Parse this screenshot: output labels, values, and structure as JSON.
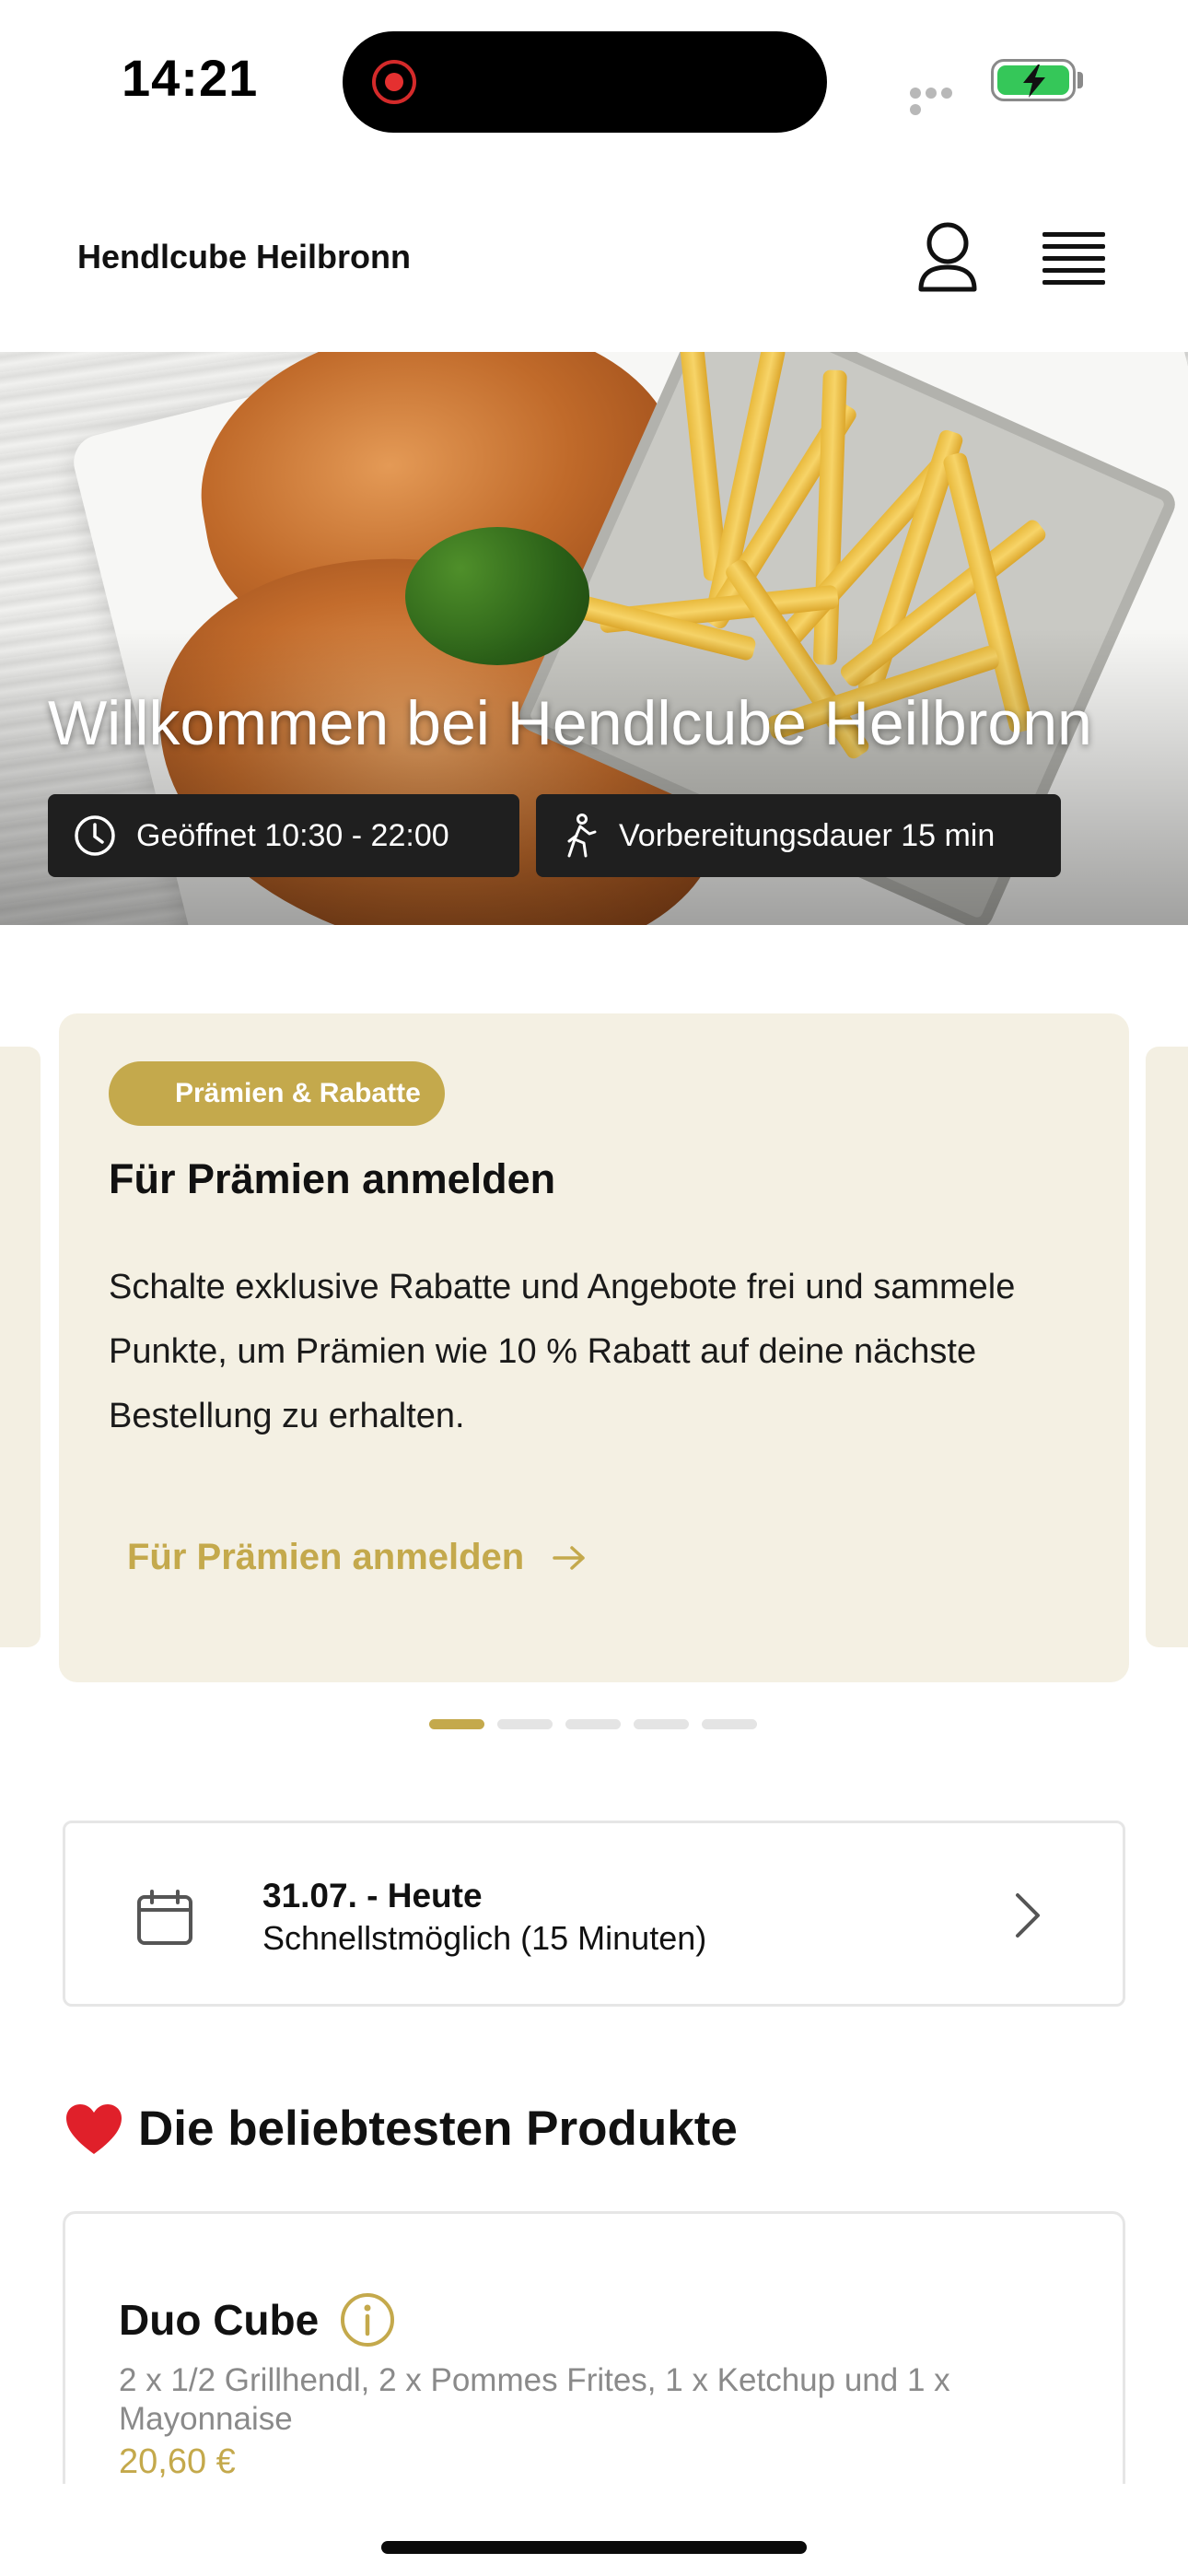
{
  "status_bar": {
    "time": "14:21"
  },
  "header": {
    "brand": "Hendlcube Heilbronn",
    "icons": [
      "user-icon",
      "menu-icon"
    ]
  },
  "hero": {
    "title": "Willkommen bei Hendlcube Heilbronn",
    "opening_hours": "Geöffnet 10:30 - 22:00",
    "prep_time": "Vorbereitungsdauer 15 min",
    "icons": [
      "clock-icon",
      "walking-icon"
    ]
  },
  "promo": {
    "badge": "Prämien & Rabatte",
    "title": "Für Prämien anmelden",
    "text": "Schalte exklusive Rabatte und Angebote frei und sammele Punkte, um Prämien wie 10 % Rabatt auf deine nächste Bestellung zu erhalten.",
    "link": "Für Prämien anmelden",
    "slides_total": 5,
    "active_slide": 1
  },
  "schedule": {
    "date": "31.07. - Heute",
    "time": "Schnellstmöglich (15 Minuten)"
  },
  "popular": {
    "title": "Die beliebtesten Produkte",
    "products": [
      {
        "name": "Duo Cube",
        "description": "2 x 1/2 Grillhendl, 2 x Pommes Frites, 1 x Ketchup und 1 x Mayonnaise",
        "price": "20,60 €"
      }
    ]
  },
  "colors": {
    "accent": "#c4a94c",
    "promo_bg": "#f4f0e3",
    "pill_bg": "#1f1f1f"
  }
}
